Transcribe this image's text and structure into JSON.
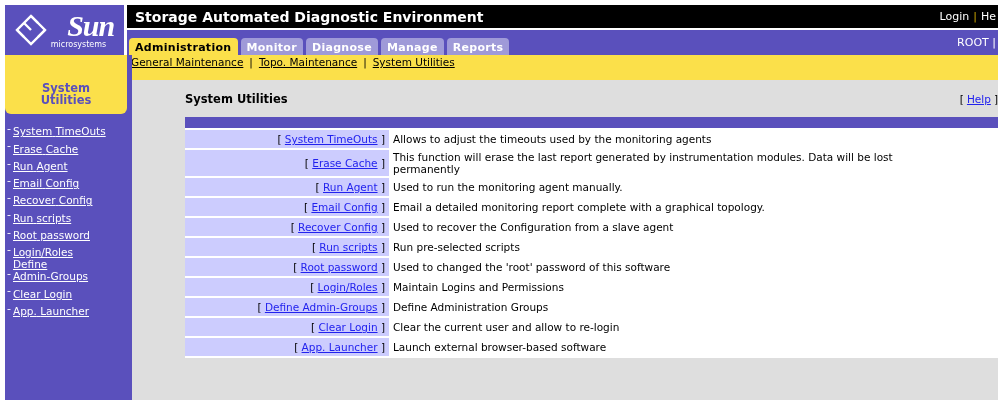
{
  "logo": {
    "name": "Sun",
    "tagline": "microsystems"
  },
  "header": {
    "title": "Storage Automated Diagnostic Environment",
    "links": [
      "Login",
      "He"
    ],
    "separator": "|"
  },
  "tabs": [
    {
      "label": "Administration",
      "selected": true
    },
    {
      "label": "Monitor",
      "selected": false
    },
    {
      "label": "Diagnose",
      "selected": false
    },
    {
      "label": "Manage",
      "selected": false
    },
    {
      "label": "Reports",
      "selected": false
    }
  ],
  "user": {
    "name": "ROOT",
    "separator": "|"
  },
  "subnav": {
    "links": [
      "General Maintenance",
      "Topo. Maintenance",
      "System Utilities"
    ],
    "separator": "|"
  },
  "sidebar": {
    "title": "System Utilities",
    "items": [
      {
        "bullet": "-",
        "label": "System TimeOuts"
      },
      {
        "bullet": "-",
        "label": "Erase Cache"
      },
      {
        "bullet": "-",
        "label": "Run Agent"
      },
      {
        "bullet": "-",
        "label": "Email Config"
      },
      {
        "bullet": "-",
        "label": "Recover Config"
      },
      {
        "bullet": "-",
        "label": "Run scripts"
      },
      {
        "bullet": "-",
        "label": "Root password"
      },
      {
        "bullet": "-",
        "label": "Login/Roles"
      },
      {
        "bullet": "-",
        "label": "Define Admin-Groups"
      },
      {
        "bullet": "-",
        "label": "Clear Login"
      },
      {
        "bullet": "-",
        "label": "App. Launcher"
      }
    ]
  },
  "content": {
    "title": "System Utilities",
    "help": {
      "open": "[",
      "label": "Help",
      "close": "]"
    },
    "rows": [
      {
        "open": "[",
        "link": "System TimeOuts",
        "close": "]",
        "description": "Allows to adjust the timeouts used by the monitoring agents"
      },
      {
        "open": "[",
        "link": "Erase Cache",
        "close": "]",
        "description": "This function will erase the last report generated by instrumentation modules. Data will be lost permanently"
      },
      {
        "open": "[",
        "link": "Run Agent",
        "close": "]",
        "description": "Used to run the monitoring agent manually."
      },
      {
        "open": "[",
        "link": "Email Config",
        "close": "]",
        "description": "Email a detailed monitoring report complete with a graphical topology."
      },
      {
        "open": "[",
        "link": "Recover Config",
        "close": "]",
        "description": "Used to recover the Configuration from a slave agent"
      },
      {
        "open": "[",
        "link": "Run scripts",
        "close": "]",
        "description": "Run pre-selected scripts"
      },
      {
        "open": "[",
        "link": "Root password",
        "close": "]",
        "description": "Used to changed the 'root' password of this software"
      },
      {
        "open": "[",
        "link": "Login/Roles",
        "close": "]",
        "description": "Maintain Logins and Permissions"
      },
      {
        "open": "[",
        "link": "Define Admin-Groups",
        "close": "]",
        "description": "Define Administration Groups"
      },
      {
        "open": "[",
        "link": "Clear Login",
        "close": "]",
        "description": "Clear the current user and allow to re-login"
      },
      {
        "open": "[",
        "link": "App. Launcher",
        "close": "]",
        "description": "Launch external browser-based software"
      }
    ]
  }
}
